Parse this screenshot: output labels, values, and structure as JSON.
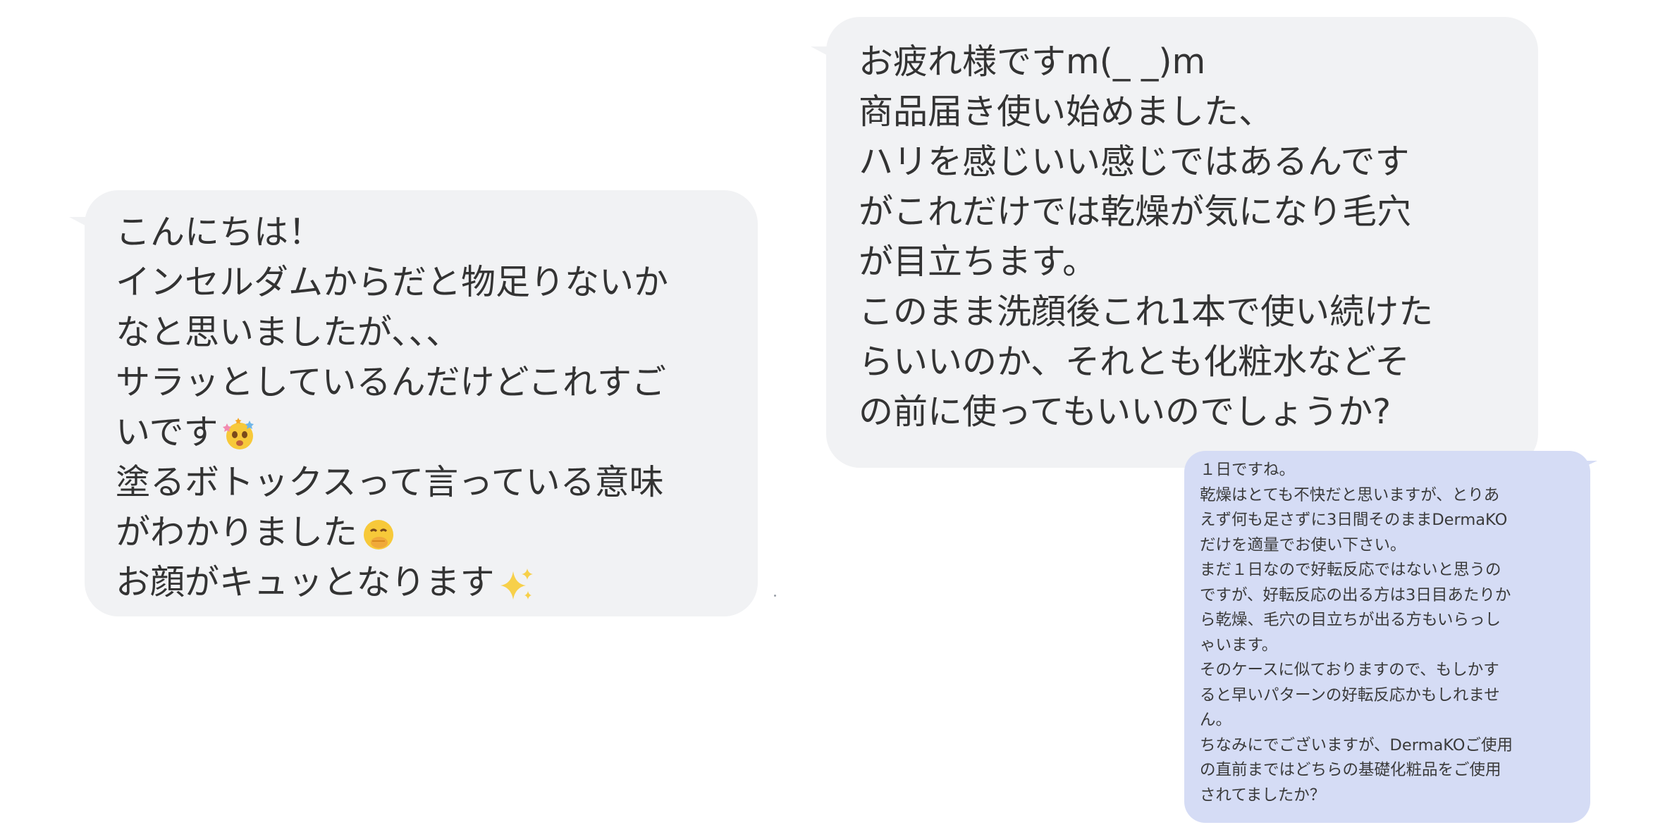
{
  "messages": {
    "left_bubble": {
      "lines": [
        "こんにちは！",
        "インセルダムからだと物足りないか",
        "なと思いましたが、、、",
        "サラッとしているんだけどこれすご",
        "いです",
        "塗るボトックスって言っている意味",
        "がわかりました",
        "お顔がキュッとなります"
      ],
      "emojis": [
        "star-struck-face-icon",
        "hand-over-mouth-face-icon",
        "sparkles-icon"
      ]
    },
    "right_top_bubble": {
      "lines": [
        "お疲れ様ですm(_ _)m",
        "商品届き使い始めました、",
        "ハリを感じいい感じではあるんです",
        "がこれだけでは乾燥が気になり毛穴",
        "が目立ちます。",
        "このまま洗顔後これ1本で使い続けた",
        "らいいのか、それとも化粧水などそ",
        "の前に使ってもいいのでしょうか?"
      ]
    },
    "reply_bubble": {
      "lines": [
        "１日ですね。",
        "乾燥はとても不快だと思いますが、とりあ",
        "えず何も足さずに3日間そのままDermaKO",
        "だけを適量でお使い下さい。",
        "まだ１日なので好転反応ではないと思うの",
        "ですが、好転反応の出る方は3日目あたりか",
        "ら乾燥、毛穴の目立ちが出る方もいらっし",
        "ゃいます。",
        "そのケースに似ておりますので、もしかす",
        "ると早いパターンの好転反応かもしれませ",
        "ん。",
        "ちなみにでございますが、DermaKOご使用",
        "の直前まではどちらの基礎化粧品をご使用",
        "されてましたか？"
      ]
    }
  },
  "colors": {
    "received_bubble": "#f1f2f4",
    "sent_bubble": "#d5dcf5",
    "text": "#333333",
    "background": "#ffffff"
  }
}
